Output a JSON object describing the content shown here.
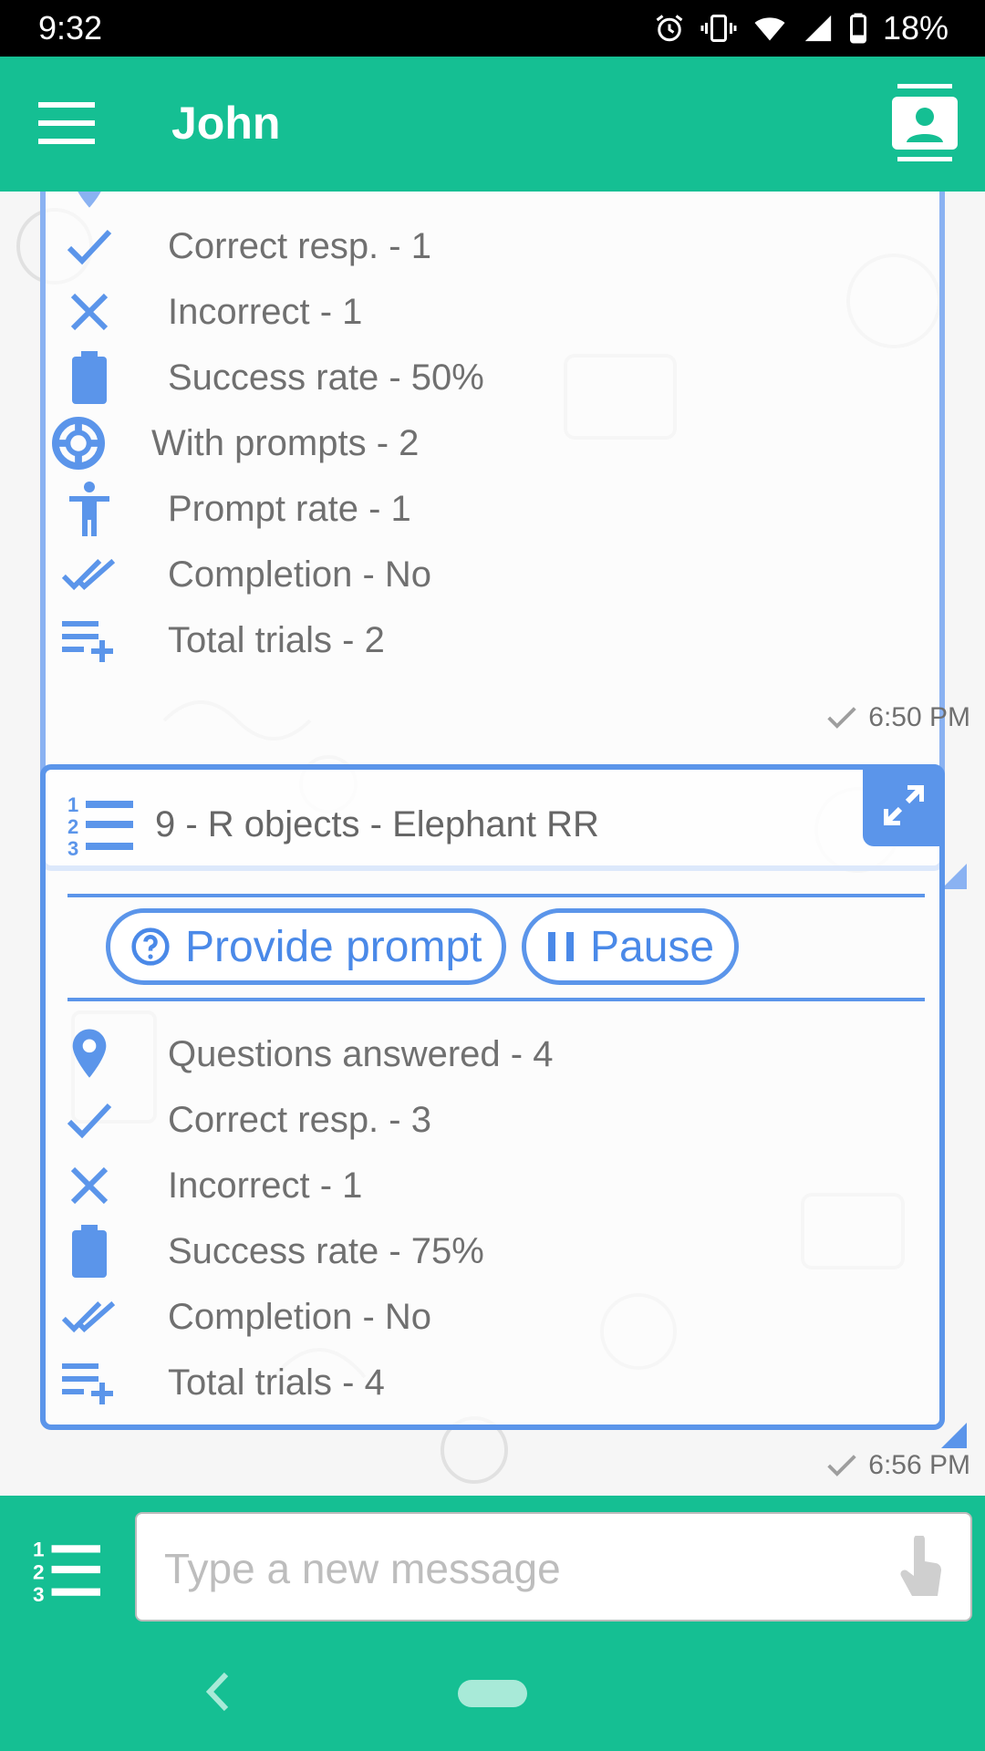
{
  "status_bar": {
    "time": "9:32",
    "battery": "18%"
  },
  "app_bar": {
    "title": "John"
  },
  "card1": {
    "rows": [
      {
        "icon": "check-icon",
        "label": "Correct resp. - 1"
      },
      {
        "icon": "close-icon",
        "label": "Incorrect - 1"
      },
      {
        "icon": "battery-icon",
        "label": "Success rate - 50%"
      },
      {
        "icon": "lifebuoy-icon",
        "label": "With prompts - 2"
      },
      {
        "icon": "person-icon",
        "label": "Prompt rate - 1"
      },
      {
        "icon": "double-check-icon",
        "label": "Completion - No"
      },
      {
        "icon": "playlist-add-icon",
        "label": "Total trials - 2"
      }
    ],
    "time": "6:50 PM"
  },
  "card2": {
    "title": "9 - R objects - Elephant RR",
    "buttons": {
      "prompt": "Provide prompt",
      "pause": "Pause"
    },
    "rows": [
      {
        "icon": "location-pin-icon",
        "label": "Questions answered - 4"
      },
      {
        "icon": "check-icon",
        "label": "Correct resp. - 3"
      },
      {
        "icon": "close-icon",
        "label": "Incorrect - 1"
      },
      {
        "icon": "battery-icon",
        "label": "Success rate - 75%"
      },
      {
        "icon": "double-check-icon",
        "label": "Completion - No"
      },
      {
        "icon": "playlist-add-icon",
        "label": "Total trials - 4"
      }
    ],
    "time": "6:56 PM"
  },
  "input": {
    "placeholder": "Type a new message"
  },
  "colors": {
    "primary": "#15bf93",
    "accent": "#5b95ea",
    "text": "#707070"
  }
}
